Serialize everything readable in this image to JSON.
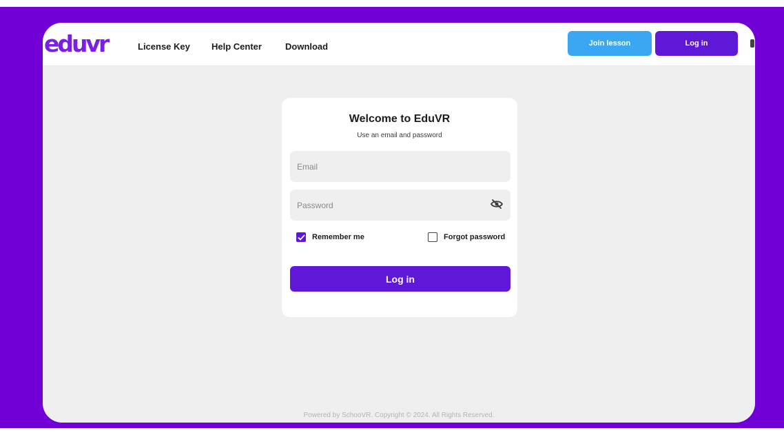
{
  "brand": {
    "logo_text": "eduvr",
    "logo_color": "#7a1fe6",
    "accent": "#6018d8",
    "join_color": "#3aa7f5"
  },
  "nav": {
    "links": [
      "License Key",
      "Help Center",
      "Download"
    ]
  },
  "header_actions": {
    "join_label": "Join lesson",
    "login_label": "Log in"
  },
  "login": {
    "title": "Welcome to EduVR",
    "subtitle": "Use an email and password",
    "email_placeholder": "Email",
    "password_placeholder": "Password",
    "remember_label": "Remember me",
    "remember_checked": true,
    "forgot_label": "Forgot password",
    "forgot_checked": false,
    "submit_label": "Log in"
  },
  "footer": {
    "text": "Powered by SchooVR. Copyright © 2024. All Rights Reserved."
  },
  "icons": {
    "eye": "eye-slash-icon",
    "check": "checkmark-icon"
  }
}
